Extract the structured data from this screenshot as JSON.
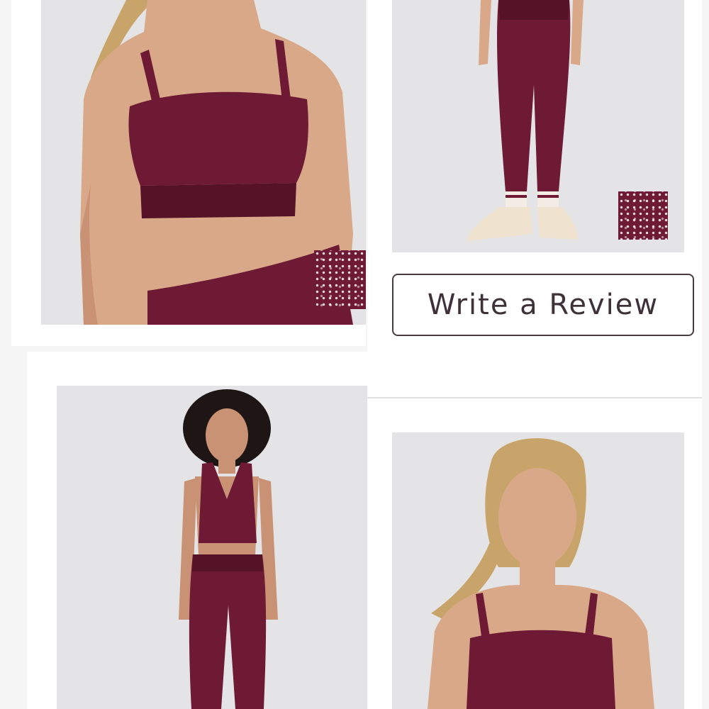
{
  "review": {
    "button_label": "Write a Review"
  },
  "colors": {
    "garment": "#6e1a35",
    "button_border": "#4a3b42",
    "button_text": "#3f3138",
    "photo_background": "#e4e4e6"
  },
  "gallery": {
    "images": [
      {
        "name": "sports-bra-front-closeup-photo",
        "has_swatch": true
      },
      {
        "name": "leggings-full-length-photo",
        "has_swatch": true
      },
      {
        "name": "set-full-body-photo",
        "has_swatch": false
      },
      {
        "name": "sports-bra-portrait-photo",
        "has_swatch": false
      }
    ]
  }
}
